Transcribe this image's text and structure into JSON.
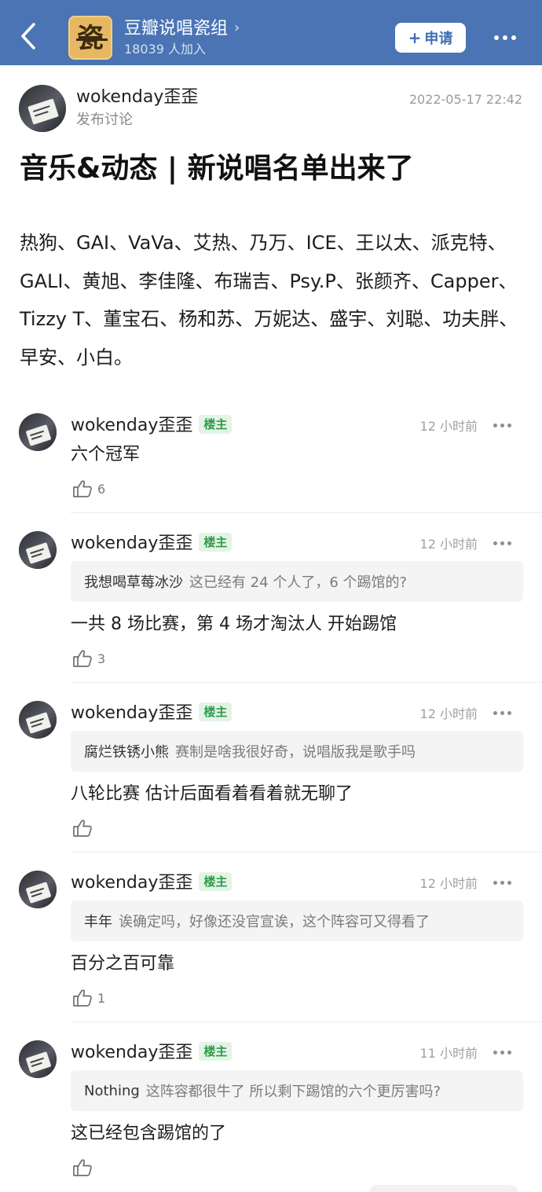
{
  "header": {
    "group_logo_char": "瓷",
    "group_name": "豆瓣说唱瓷组",
    "members": "18039 人加入",
    "apply_label": "申请",
    "accent_color": "#4a74b4"
  },
  "post": {
    "author": "wokenday歪歪",
    "action": "发布讨论",
    "time": "2022-05-17 22:42",
    "title": "音乐&动态 | 新说唱名单出来了",
    "body": "热狗、GAI、VaVa、艾热、乃万、ICE、王以太、派克特、GALI、黄旭、李佳隆、布瑞吉、Psy.P、张颜齐、Capper、Tizzy T、董宝石、杨和苏、万妮达、盛宇、刘聪、功夫胖、早安、小白。"
  },
  "comments": [
    {
      "author": "wokenday歪歪",
      "badge": "楼主",
      "time": "12 小时前",
      "quote_user": "",
      "quote_text": "",
      "text": "六个冠军",
      "likes": "6"
    },
    {
      "author": "wokenday歪歪",
      "badge": "楼主",
      "time": "12 小时前",
      "quote_user": "我想喝草莓冰沙",
      "quote_text": "这已经有 24 个人了，6 个踢馆的?",
      "text": "一共 8 场比赛，第 4 场才淘汰人   开始踢馆",
      "likes": "3"
    },
    {
      "author": "wokenday歪歪",
      "badge": "楼主",
      "time": "12 小时前",
      "quote_user": "腐烂铁锈小熊",
      "quote_text": "赛制是啥我很好奇，说唱版我是歌手吗",
      "text": "八轮比赛    估计后面看着看着就无聊了",
      "likes": ""
    },
    {
      "author": "wokenday歪歪",
      "badge": "楼主",
      "time": "12 小时前",
      "quote_user": "丰年",
      "quote_text": "诶确定吗，好像还没官宣诶，这个阵容可又得看了",
      "text": "百分之百可靠",
      "likes": "1"
    },
    {
      "author": "wokenday歪歪",
      "badge": "楼主",
      "time": "11 小时前",
      "quote_user": "Nothing",
      "quote_text": "这阵容都很牛了 所以剩下踢馆的六个更厉害吗?",
      "text": "这已经包含踢馆的了",
      "likes": ""
    }
  ]
}
